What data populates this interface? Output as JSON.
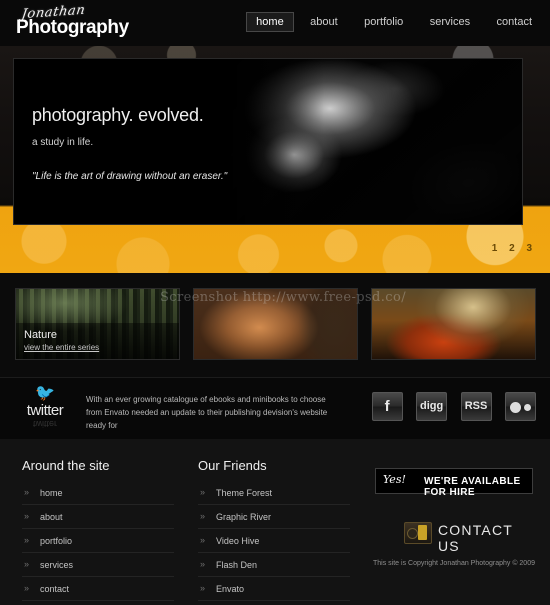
{
  "header": {
    "logo": {
      "script": "Jonathan",
      "main": "Photography"
    },
    "nav": [
      {
        "label": "home",
        "active": true
      },
      {
        "label": "about",
        "active": false
      },
      {
        "label": "portfolio",
        "active": false
      },
      {
        "label": "services",
        "active": false
      },
      {
        "label": "contact",
        "active": false
      }
    ]
  },
  "hero": {
    "headline": "photography. evolved.",
    "subhead": "a study in life.",
    "quote": "\"Life is the art of drawing without an eraser.\"",
    "pager": [
      "1",
      "2",
      "3"
    ],
    "accent_color": "#f0a712"
  },
  "watermark": {
    "text": "Screenshot http://www.free-psd.co/"
  },
  "thumbs": [
    {
      "title": "Nature",
      "link": "view the entire series"
    },
    {
      "title": "",
      "link": ""
    },
    {
      "title": "",
      "link": ""
    }
  ],
  "twitter": {
    "bird_icon": "twitter-bird-icon",
    "wordmark": "twitter",
    "tweet": "With an ever growing catalogue of ebooks and minibooks to choose from Envato needed an update to their publishing devision's website ready for",
    "social": [
      {
        "name": "facebook-icon",
        "glyph": "f"
      },
      {
        "name": "digg-icon",
        "glyph": "digg"
      },
      {
        "name": "rss-icon",
        "glyph": "RSS"
      },
      {
        "name": "flickr-icon",
        "glyph": ""
      }
    ]
  },
  "footer": {
    "around": {
      "heading": "Around the site",
      "links": [
        "home",
        "about",
        "portfolio",
        "services",
        "contact"
      ]
    },
    "friends": {
      "heading": "Our Friends",
      "links": [
        "Theme Forest",
        "Graphic River",
        "Video Hive",
        "Flash Den",
        "Envato"
      ]
    },
    "hire": {
      "yes": "Yes!",
      "text": "WE'RE AVAILABLE FOR HIRE"
    },
    "contact": {
      "label": "CONTACT US",
      "icon": "camera-icon"
    },
    "copyright": "This site is Copyright Jonathan Photography © 2009"
  }
}
